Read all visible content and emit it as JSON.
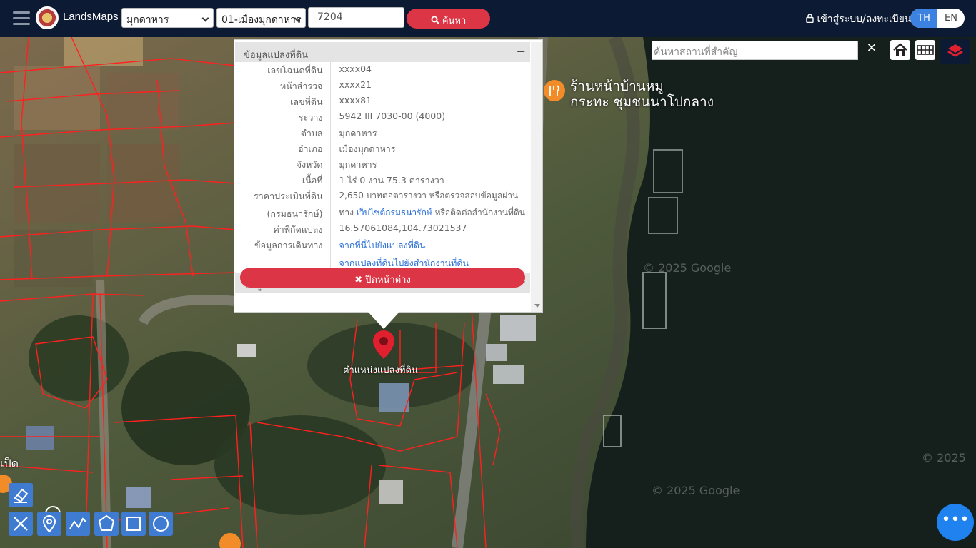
{
  "header": {
    "brand": "LandsMaps",
    "province_select": "มุกดาหาร",
    "district_select": "01-เมืองมุกดาหาร",
    "parcel_input": "7204",
    "search_label": "ค้นหา",
    "login_label": "เข้าสู่ระบบ/ลงทะเบียน",
    "lang_th": "TH",
    "lang_en": "EN"
  },
  "map_tools": {
    "place_search_placeholder": "ค้นหาสถานที่สำคัญ",
    "clear_symbol": "×"
  },
  "popup": {
    "section_parcel": "ข้อมูลแปลงที่ดิน",
    "section_office": "ข้อมูลสำนักงานที่ดิน",
    "rows": [
      {
        "key": "เลขโฉนดที่ดิน",
        "value": "xxxx04"
      },
      {
        "key": "หน้าสำรวจ",
        "value": "xxxx21"
      },
      {
        "key": "เลขที่ดิน",
        "value": "xxxx81"
      },
      {
        "key": "ระวาง",
        "value": "5942 III 7030-00 (4000)"
      },
      {
        "key": "ตำบล",
        "value": "มุกดาหาร"
      },
      {
        "key": "อำเภอ",
        "value": "เมืองมุกดาหาร"
      },
      {
        "key": "จังหวัด",
        "value": "มุกดาหาร"
      },
      {
        "key": "เนื้อที่",
        "value": "1 ไร่ 0 งาน 75.3 ตารางวา"
      }
    ],
    "price_key_1": "ราคาประเมินที่ดิน",
    "price_key_2": "(กรมธนารักษ์)",
    "price_value_1": "2,650 บาทต่อตารางวา หรือตรวจสอบข้อมูลผ่าน",
    "price_value_2a": "ทาง ",
    "price_link": "เว็บไซต์กรมธนารักษ์",
    "price_value_2b": " หรือติดต่อสำนักงานที่ดิน",
    "coord_key": "ค่าพิกัดแปลง",
    "coord_value": "16.57061084,104.73021537",
    "route_key": "ข้อมูลการเดินทาง",
    "route_link_1": "จากที่นี่ไปยังแปลงที่ดิน",
    "route_link_2": "จากแปลงที่ดินไปยังสำนักงานที่ดิน",
    "close_label": "ปิดหน้าต่าง",
    "minus_sign": "−",
    "plus_sign": "+"
  },
  "map_labels": {
    "marker_label": "ตำแหน่งแปลงที่ดิน",
    "shop_line_1": "ร้านหน้าบ้านหมู",
    "shop_line_2": "กระทะ ชุมชนนาโปกลาง",
    "left_edge_label": "ูเป็ด",
    "google_1": "© 2025 Google",
    "google_2": "© 2025 Google",
    "google_3": "© 2025"
  },
  "fab_symbol": "•••",
  "colors": {
    "topbar": "#0c1a33",
    "accent_red": "#dc3545",
    "tool_blue": "#3e7bd1",
    "link_blue": "#2a6fd6"
  }
}
